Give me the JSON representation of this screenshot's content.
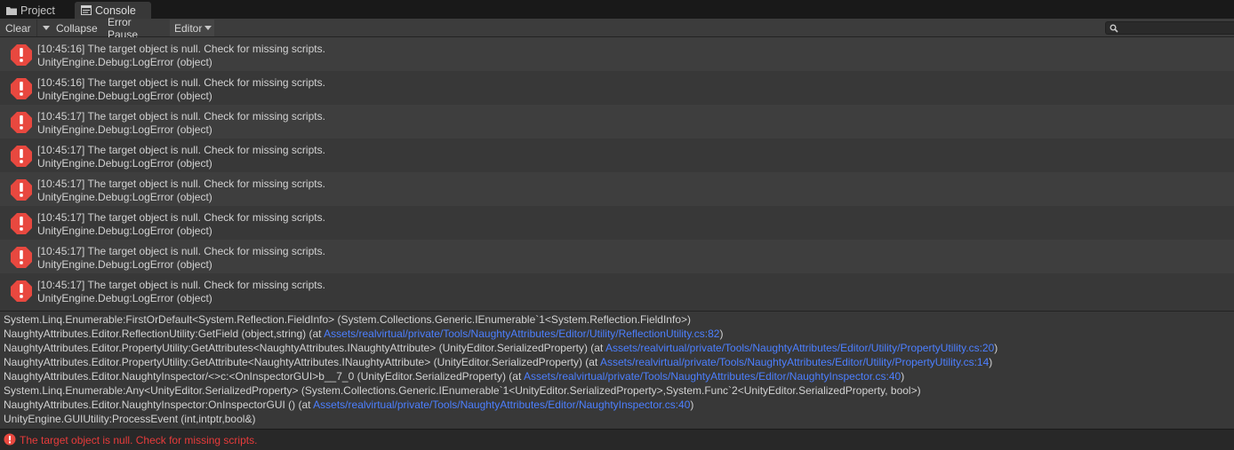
{
  "tabs": [
    {
      "label": "Project",
      "icon": "folder-icon"
    },
    {
      "label": "Console",
      "icon": "console-icon"
    }
  ],
  "toolbar": {
    "clear_label": "Clear",
    "collapse_label": "Collapse",
    "error_pause_label": "Error Pause",
    "editor_label": "Editor",
    "search_value": ""
  },
  "logs": [
    {
      "line1": "[10:45:16] The target object is null. Check for missing scripts.",
      "line2": "UnityEngine.Debug:LogError (object)"
    },
    {
      "line1": "[10:45:16] The target object is null. Check for missing scripts.",
      "line2": "UnityEngine.Debug:LogError (object)"
    },
    {
      "line1": "[10:45:17] The target object is null. Check for missing scripts.",
      "line2": "UnityEngine.Debug:LogError (object)"
    },
    {
      "line1": "[10:45:17] The target object is null. Check for missing scripts.",
      "line2": "UnityEngine.Debug:LogError (object)"
    },
    {
      "line1": "[10:45:17] The target object is null. Check for missing scripts.",
      "line2": "UnityEngine.Debug:LogError (object)"
    },
    {
      "line1": "[10:45:17] The target object is null. Check for missing scripts.",
      "line2": "UnityEngine.Debug:LogError (object)"
    },
    {
      "line1": "[10:45:17] The target object is null. Check for missing scripts.",
      "line2": "UnityEngine.Debug:LogError (object)"
    },
    {
      "line1": "[10:45:17] The target object is null. Check for missing scripts.",
      "line2": "UnityEngine.Debug:LogError (object)"
    }
  ],
  "stack_trace": [
    {
      "pre": "System.Linq.Enumerable:FirstOrDefault<System.Reflection.FieldInfo> (System.Collections.Generic.IEnumerable`1<System.Reflection.FieldInfo>)",
      "link": "",
      "post": ""
    },
    {
      "pre": "NaughtyAttributes.Editor.ReflectionUtility:GetField (object,string) (at ",
      "link": "Assets/realvirtual/private/Tools/NaughtyAttributes/Editor/Utility/ReflectionUtility.cs:82",
      "post": ")"
    },
    {
      "pre": "NaughtyAttributes.Editor.PropertyUtility:GetAttributes<NaughtyAttributes.INaughtyAttribute> (UnityEditor.SerializedProperty) (at ",
      "link": "Assets/realvirtual/private/Tools/NaughtyAttributes/Editor/Utility/PropertyUtility.cs:20",
      "post": ")"
    },
    {
      "pre": "NaughtyAttributes.Editor.PropertyUtility:GetAttribute<NaughtyAttributes.INaughtyAttribute> (UnityEditor.SerializedProperty) (at ",
      "link": "Assets/realvirtual/private/Tools/NaughtyAttributes/Editor/Utility/PropertyUtility.cs:14",
      "post": ")"
    },
    {
      "pre": "NaughtyAttributes.Editor.NaughtyInspector/<>c:<OnInspectorGUI>b__7_0 (UnityEditor.SerializedProperty) (at ",
      "link": "Assets/realvirtual/private/Tools/NaughtyAttributes/Editor/NaughtyInspector.cs:40",
      "post": ")"
    },
    {
      "pre": "System.Linq.Enumerable:Any<UnityEditor.SerializedProperty> (System.Collections.Generic.IEnumerable`1<UnityEditor.SerializedProperty>,System.Func`2<UnityEditor.SerializedProperty, bool>)",
      "link": "",
      "post": ""
    },
    {
      "pre": "NaughtyAttributes.Editor.NaughtyInspector:OnInspectorGUI () (at ",
      "link": "Assets/realvirtual/private/Tools/NaughtyAttributes/Editor/NaughtyInspector.cs:40",
      "post": ")"
    },
    {
      "pre": "UnityEngine.GUIUtility:ProcessEvent (int,intptr,bool&)",
      "link": "",
      "post": ""
    }
  ],
  "status": {
    "message": "The target object is null. Check for missing scripts.",
    "icon": "error-icon"
  },
  "colors": {
    "error_red": "#e8483f",
    "link_blue": "#4c7fff",
    "status_text": "#e83b3b"
  }
}
